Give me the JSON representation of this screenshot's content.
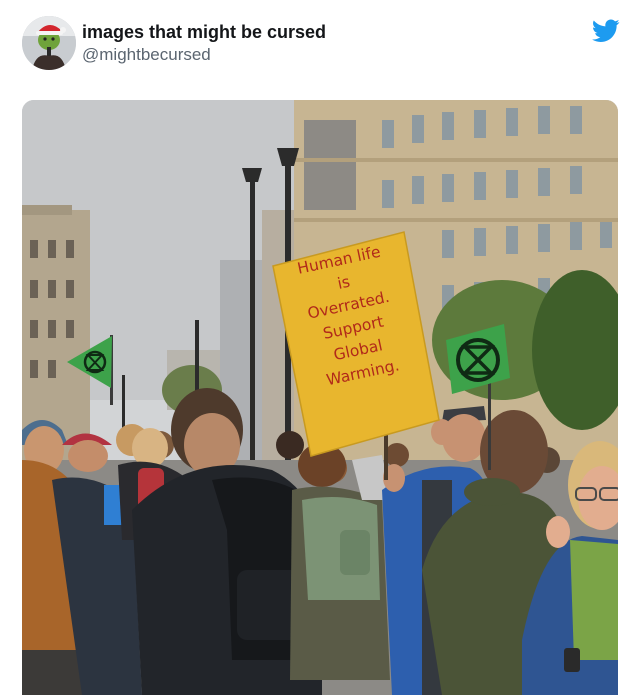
{
  "tweet": {
    "display_name": "images that might be cursed",
    "handle": "@mightbecursed",
    "avatar_icon": "grinch-santa-avatar-icon",
    "brand_icon": "twitter-bird-icon",
    "brand_color": "#1d9bf0"
  },
  "photo": {
    "sign": {
      "lines_top": [
        "Human life",
        "is",
        "Overrated."
      ],
      "lines_bottom": [
        "Support",
        "Global",
        "Warming."
      ],
      "sign_color": "#e8b62e",
      "text_color": "#b12a1a"
    },
    "flag_icon": "extinction-rebellion-flag-icon",
    "flag_color": "#3da24a"
  }
}
